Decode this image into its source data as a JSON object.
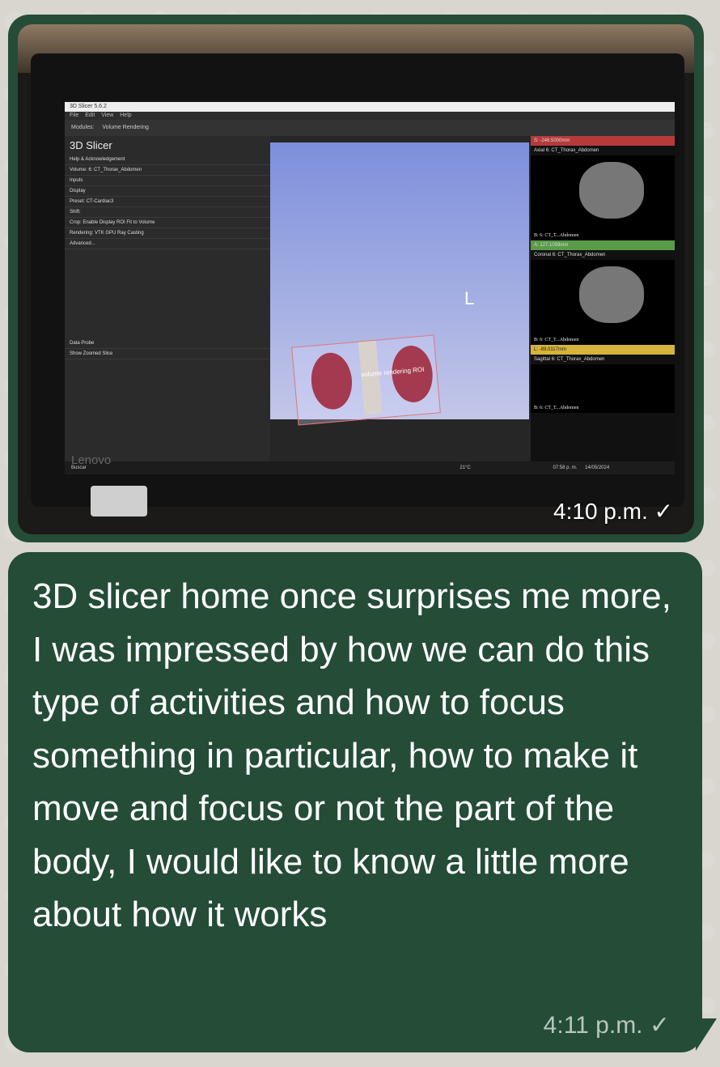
{
  "photo_message": {
    "timestamp": "4:10 p.m.",
    "status_icon": "check-icon",
    "screen": {
      "window_title": "3D Slicer 5.6.2",
      "menu": [
        "File",
        "Edit",
        "View",
        "Help"
      ],
      "module_label": "Modules:",
      "module_value": "Volume Rendering",
      "app_name": "3D Slicer",
      "help_row": "Help & Acknowledgement",
      "volume_label": "Volume:",
      "volume_value": "6: CT_Thorax_Abdomen",
      "inputs": "Inputs",
      "display": "Display",
      "preset_label": "Preset:",
      "preset_value": "CT-Cardiac3",
      "shift_label": "Shift:",
      "crop_label": "Crop:",
      "enable": "Enable",
      "display_roi": "Display ROI",
      "fit_volume": "Fit to Volume",
      "rendering_label": "Rendering:",
      "rendering_value": "VTK GPU Ray Casting",
      "advanced": "Advanced...",
      "data_probe": "Data Probe",
      "show_zoomed": "Show Zoomed Slice",
      "view_letter": "L",
      "roi_label": "volume rendering ROI",
      "axial": "Axial",
      "coronal": "Coronal",
      "sagittal": "Sagittal",
      "slice_series": "6: CT_Thorax_Abdomen",
      "slice_b_label": "B: 6: CT_T...Abdomen",
      "a_value": "A: 127.1059mm",
      "l_value": "L: -89.0117mm",
      "s_value": "S: -246.5000mm",
      "search": "Buscar",
      "temp": "21°C",
      "clock_time": "07:58 p. m.",
      "clock_date": "14/05/2024",
      "brand": "Lenovo"
    }
  },
  "text_message": {
    "text": "3D slicer home once surprises me more, I was impressed by how we can do this type of activities and how to focus something in particular, how to make it move and focus or not the part of the body, I would like to know a little more about how it works",
    "timestamp": "4:11 p.m.",
    "status_icon": "check-icon"
  },
  "colors": {
    "bubble": "#244c37",
    "background": "#d9d5cf"
  }
}
